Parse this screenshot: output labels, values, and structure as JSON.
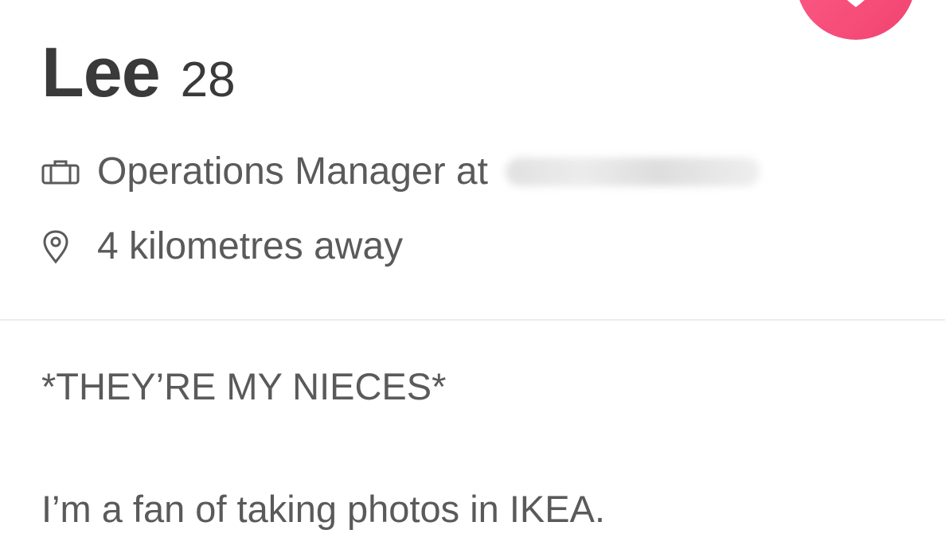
{
  "profile": {
    "name": "Lee",
    "age": "28",
    "job": {
      "icon": "briefcase-icon",
      "title": "Operations Manager at"
    },
    "distance": {
      "icon": "location-pin-icon",
      "text": "4 kilometres away"
    },
    "bio": {
      "line1": "*THEY’RE MY NIECES*",
      "line2": "I’m a fan of taking photos in IKEA."
    }
  },
  "actions": {
    "like_icon": "heart-icon",
    "like_color": "#f74a76"
  },
  "colors": {
    "text_primary": "#3a3a3a",
    "text_secondary": "#5a5a5a",
    "divider": "#ececec",
    "background": "#ffffff"
  }
}
